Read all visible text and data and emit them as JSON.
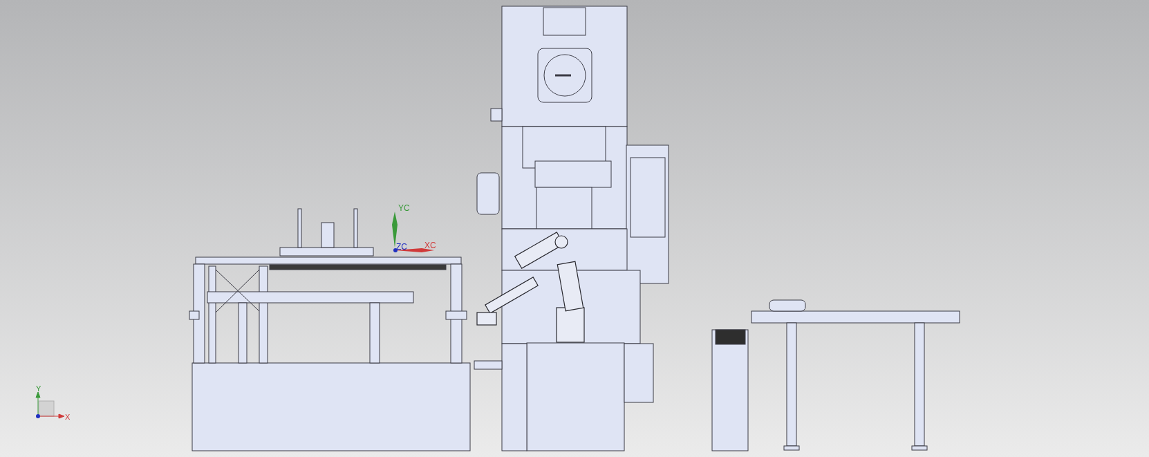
{
  "viewport": {
    "wcs": {
      "y_label": "YC",
      "x_label": "XC",
      "z_label": "ZC"
    },
    "view_triad": {
      "y_label": "Y",
      "x_label": "X"
    }
  }
}
